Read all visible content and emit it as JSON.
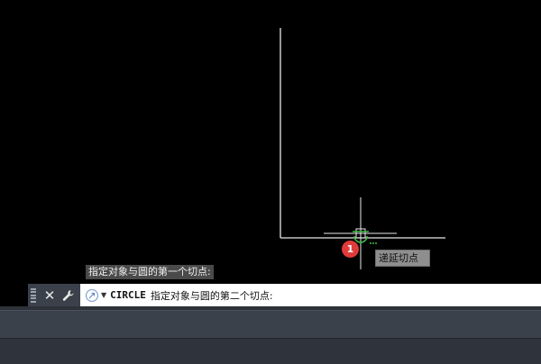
{
  "drawing": {
    "prev_prompt": "指定对象与圆的第一个切点:",
    "snap_tooltip": "递延切点",
    "step_badge": "1"
  },
  "command_line": {
    "command_name": "CIRCLE",
    "prompt": "指定对象与圆的第二个切点:",
    "icons": {
      "close": "close-icon",
      "customize": "wrench-icon",
      "recent": "recent-commands-icon",
      "dropdown": "chevron-down-icon"
    }
  },
  "colors": {
    "canvas": "#000000",
    "geometry": "#e8e8e8",
    "snap_marker": "#3fbf3f",
    "badge": "#e03a3a",
    "command_bar": "#3b414b"
  }
}
